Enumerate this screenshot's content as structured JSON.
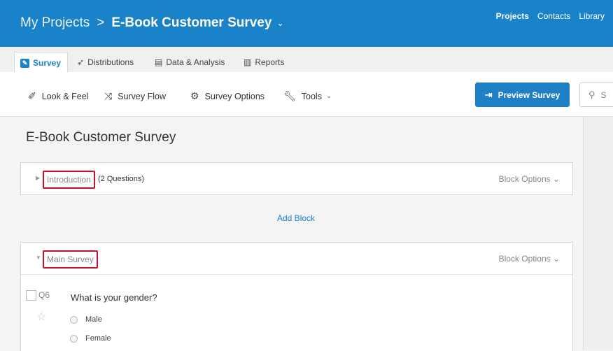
{
  "header": {
    "root": "My Projects",
    "separator": ">",
    "current": "E-Book Customer Survey",
    "caret": "⌄",
    "nav": [
      "Projects",
      "Contacts",
      "Library"
    ]
  },
  "tabs": [
    {
      "label": "Survey",
      "icon": "edit-icon"
    },
    {
      "label": "Distributions",
      "icon": "send-icon"
    },
    {
      "label": "Data & Analysis",
      "icon": "data-icon"
    },
    {
      "label": "Reports",
      "icon": "reports-icon"
    }
  ],
  "toolbar": {
    "look_feel": "Look & Feel",
    "survey_flow": "Survey Flow",
    "survey_options": "Survey Options",
    "tools": "Tools",
    "preview": "Preview Survey",
    "search_placeholder": "S"
  },
  "survey": {
    "title": "E-Book Customer Survey",
    "add_block": "Add Block",
    "blocks": [
      {
        "name": "Introduction",
        "count": "(2 Questions)",
        "options": "Block Options ⌄"
      },
      {
        "name": "Main Survey",
        "options": "Block Options ⌄"
      }
    ],
    "question": {
      "number": "Q6",
      "text": "What is your gender?",
      "choices": [
        "Male",
        "Female"
      ]
    }
  },
  "colors": {
    "primary": "#1a82c8",
    "highlight": "#c8102e"
  }
}
